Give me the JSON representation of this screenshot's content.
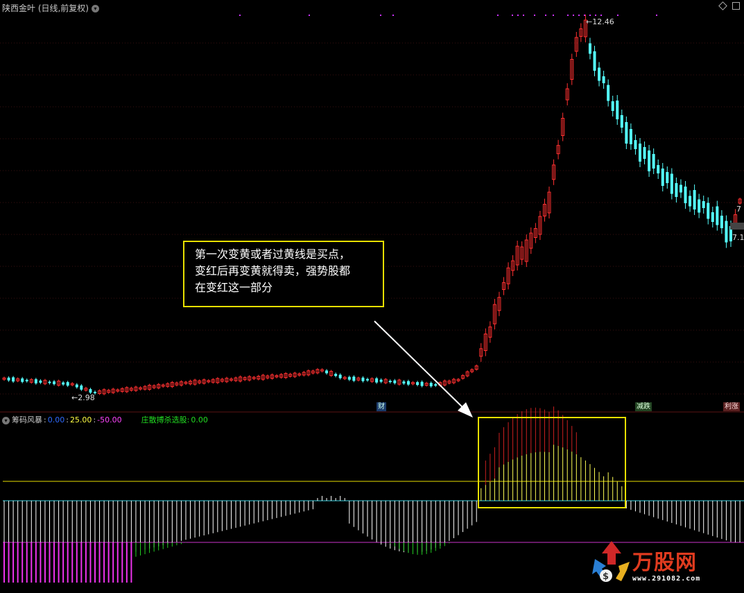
{
  "window": {
    "title": "陕西金叶 (日线,前复权)"
  },
  "indicator": {
    "name": "筹码风暴",
    "v1": "0.00",
    "v2": "25.00",
    "v3": "-50.00",
    "label2": "庄散搏杀选股:",
    "v4": "0.00",
    "sep": ":",
    "colors": {
      "v1": "#2f6bff",
      "v2": "#ffff44",
      "v3": "#ff44ff",
      "label2": "#22dd22"
    }
  },
  "annotation": {
    "lines": [
      "第一次变黄或者过黄线是买点，",
      "变红后再变黄就得卖，强势股都",
      "在变红这一部分"
    ]
  },
  "price_labels": {
    "high": "12.46",
    "low": "2.98",
    "right1": "7",
    "right2": "7.1"
  },
  "markers": {
    "cai": "财",
    "drop": "减跌",
    "rise": "利涨"
  },
  "logo": {
    "text": "万股网",
    "url": "www.291082.com"
  },
  "colors": {
    "up": "#ff3030",
    "down": "#54ffff",
    "yellow_line": "#e8e000",
    "cyan_line": "#38d8e8",
    "magenta_line": "#cc33cc",
    "bg": "#000000"
  }
}
